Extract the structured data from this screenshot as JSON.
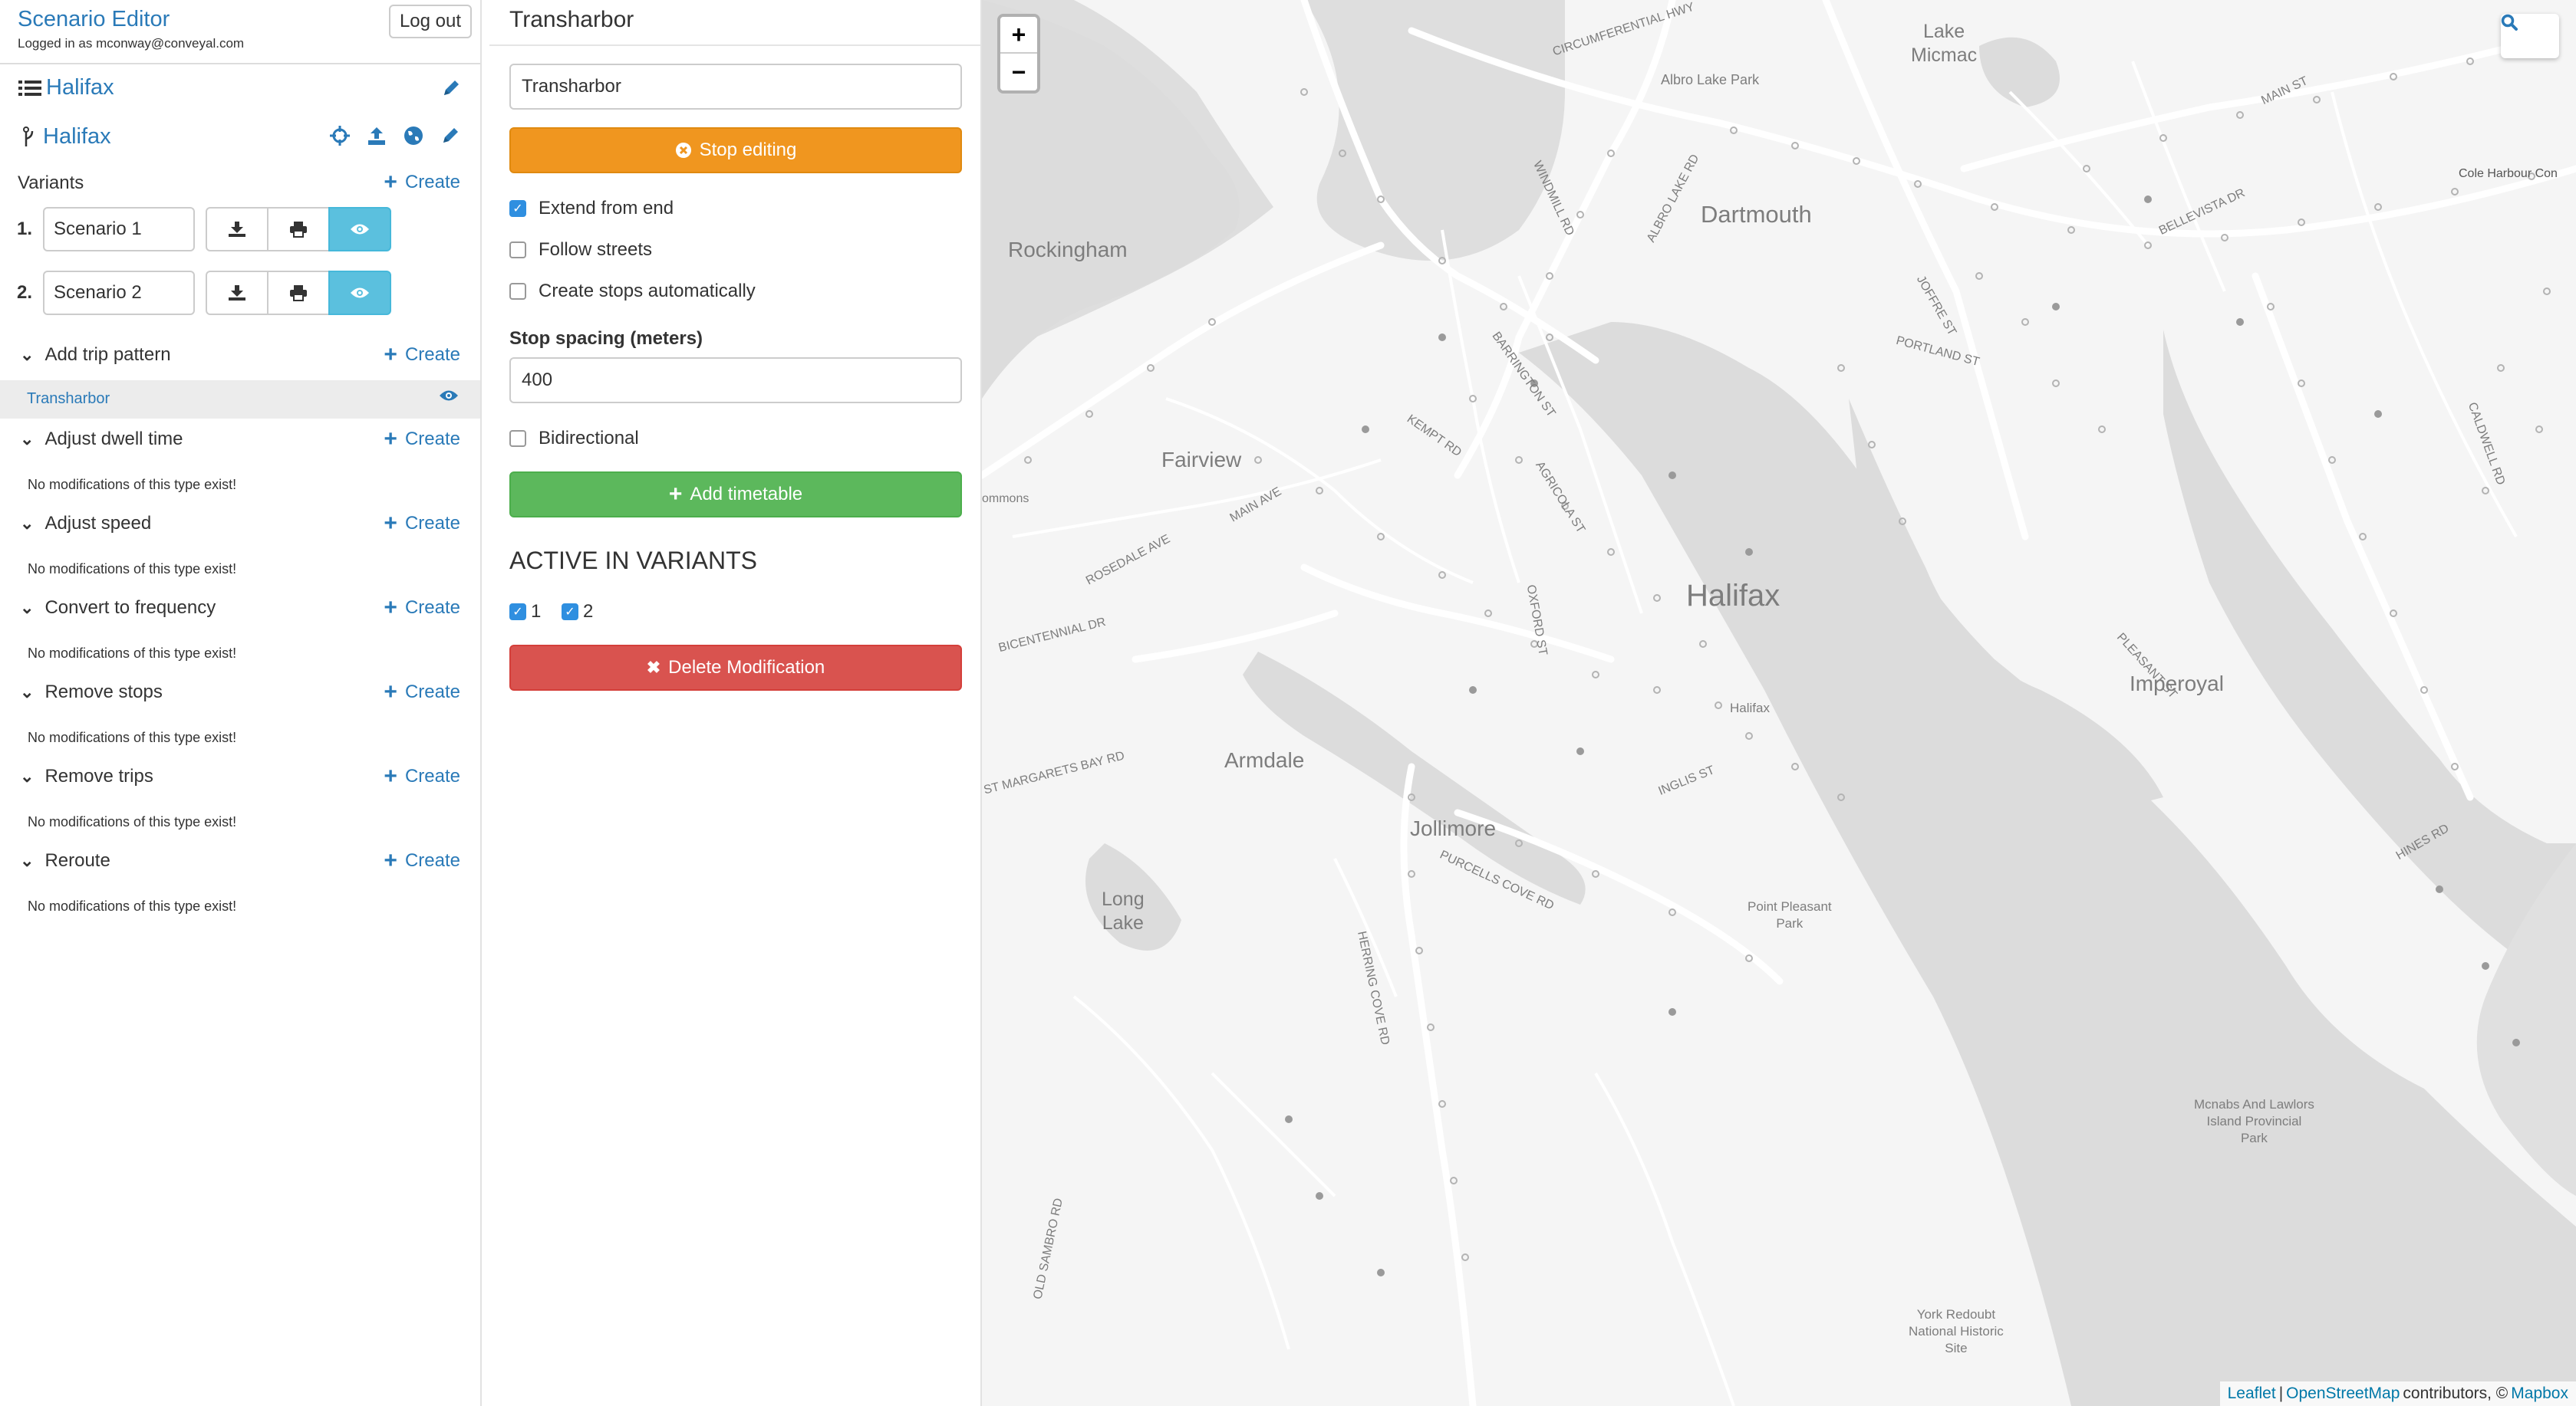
{
  "app": {
    "title": "Scenario Editor",
    "logged_in": "Logged in as mconway@conveyal.com",
    "logout_label": "Log out"
  },
  "project": {
    "name": "Halifax"
  },
  "bundle": {
    "name": "Halifax"
  },
  "variants": {
    "label": "Variants",
    "create_label": "Create",
    "items": [
      {
        "num": "1.",
        "name": "Scenario 1"
      },
      {
        "num": "2.",
        "name": "Scenario 2"
      }
    ]
  },
  "modifications": {
    "create_label": "Create",
    "empty_text": "No modifications of this type exist!",
    "sections": [
      {
        "label": "Add trip pattern"
      },
      {
        "label": "Adjust dwell time"
      },
      {
        "label": "Adjust speed"
      },
      {
        "label": "Convert to frequency"
      },
      {
        "label": "Remove stops"
      },
      {
        "label": "Remove trips"
      },
      {
        "label": "Reroute"
      }
    ],
    "selected_item": "Transharbor"
  },
  "editor": {
    "title": "Transharbor",
    "name_value": "Transharbor",
    "stop_editing_label": "Stop editing",
    "extend_from_end_label": "Extend from end",
    "extend_from_end_checked": true,
    "follow_streets_label": "Follow streets",
    "follow_streets_checked": false,
    "create_stops_label": "Create stops automatically",
    "create_stops_checked": false,
    "stop_spacing_label": "Stop spacing (meters)",
    "stop_spacing_value": "400",
    "bidirectional_label": "Bidirectional",
    "bidirectional_checked": false,
    "add_timetable_label": "Add timetable",
    "active_heading": "ACTIVE IN VARIANTS",
    "active_variants": [
      {
        "label": "1",
        "checked": true
      },
      {
        "label": "2",
        "checked": true
      }
    ],
    "delete_label": "Delete Modification"
  },
  "map": {
    "zoom_in": "+",
    "zoom_out": "−",
    "labels": {
      "lake_micmac_1": "Lake",
      "lake_micmac_2": "Micmac",
      "albro_lake_park": "Albro Lake Park",
      "dartmouth": "Dartmouth",
      "rockingham": "Rockingham",
      "fairview": "Fairview",
      "halifax_big": "Halifax",
      "halifax_small": "Halifax",
      "armdale": "Armdale",
      "jollimore": "Jollimore",
      "long_lake_1": "Long",
      "long_lake_2": "Lake",
      "imperoyal": "Imperoyal",
      "point_pleasant_1": "Point Pleasant",
      "point_pleasant_2": "Park",
      "mcnabs_1": "Mcnabs And Lawlors",
      "mcnabs_2": "Island Provincial",
      "mcnabs_3": "Park",
      "york_1": "York Redoubt",
      "york_2": "National Historic",
      "york_3": "Site",
      "commons": "ommons",
      "cole_harbour": "Cole Harbour Con",
      "circumferential_hwy": "CIRCUMFERENTIAL HWY",
      "main_st": "MAIN ST",
      "windmill_rd": "WINDMILL RD",
      "albro_lake_rd": "ALBRO LAKE RD",
      "barrington_st": "BARRINGTON ST",
      "kempt_rd": "KEMPT RD",
      "main_ave": "MAIN AVE",
      "rosedale_ave": "ROSEDALE AVE",
      "bicentennial_dr": "BICENTENNIAL DR",
      "margarets_bay_rd": "ST MARGARETS BAY RD",
      "herring_cove_rd": "HERRING COVE RD",
      "purcells_cove_rd": "PURCELLS COVE RD",
      "old_sambro_rd": "OLD SAMBRO RD",
      "portland_st": "PORTLAND ST",
      "joffre_st": "JOFFRE ST",
      "bellevista_dr": "BELLEVISTA DR",
      "hines_rd": "HINES RD",
      "pleasant_st": "PLEASANT ST",
      "caldwell_rd": "CALDWELL RD",
      "inglis_st": "INGLIS ST",
      "oxford_st": "OXFORD ST",
      "agricola_st": "AGRICOLA ST"
    },
    "attribution": {
      "leaflet": "Leaflet",
      "sep": "|",
      "osm": "OpenStreetMap",
      "contributors": "contributors, ©",
      "mapbox": "Mapbox"
    }
  }
}
